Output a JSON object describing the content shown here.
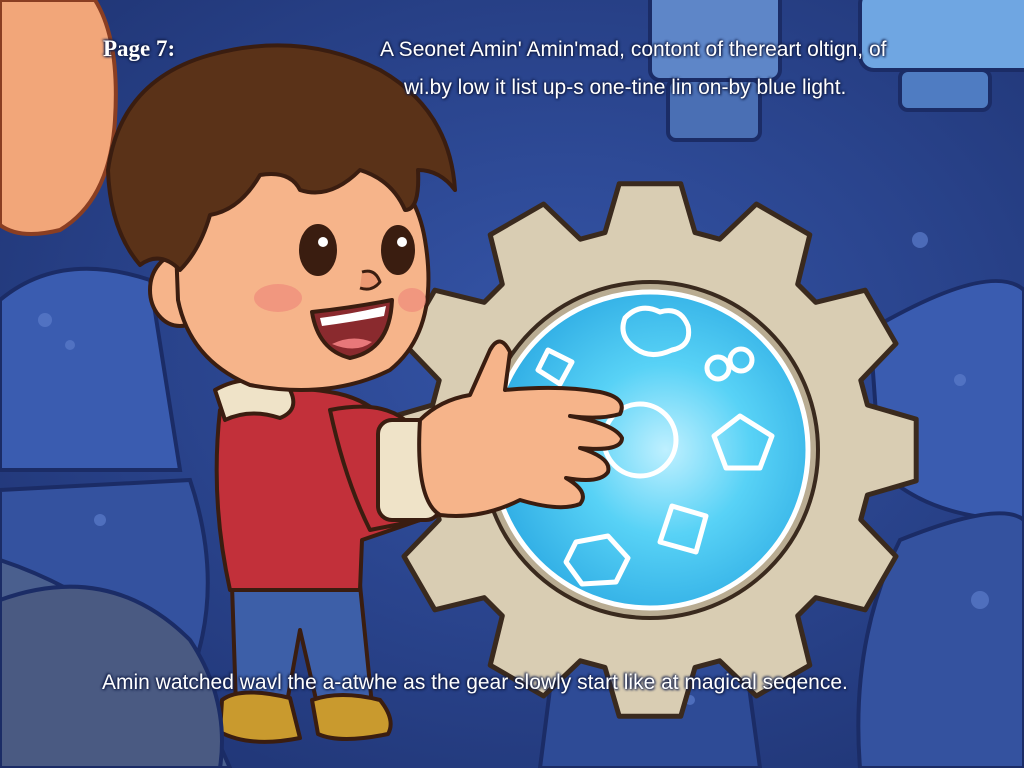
{
  "page": {
    "label": "Page 7:",
    "intro_lines": [
      "A Seonet Amin' Amin'mad, contont of thereart oltign, of",
      "wi.by low it list up-s one-tine lin on-by blue light."
    ],
    "bottom_caption": "Amin watched wavl the a-atwhe as the gear slowly start like at magical seqence."
  },
  "palette": {
    "background": "#2a4593",
    "gear_rim": "#d9cdb3",
    "gear_disc": "#47c8f0",
    "jacket": "#c2303a",
    "hair": "#5a3218",
    "skin": "#f6b48a"
  },
  "gear": {
    "teeth": 12,
    "symbol_icons": [
      "blob-icon",
      "infinity-icon",
      "pentagon-icon",
      "diamond-icon",
      "hexagon-icon",
      "square-icon"
    ]
  }
}
